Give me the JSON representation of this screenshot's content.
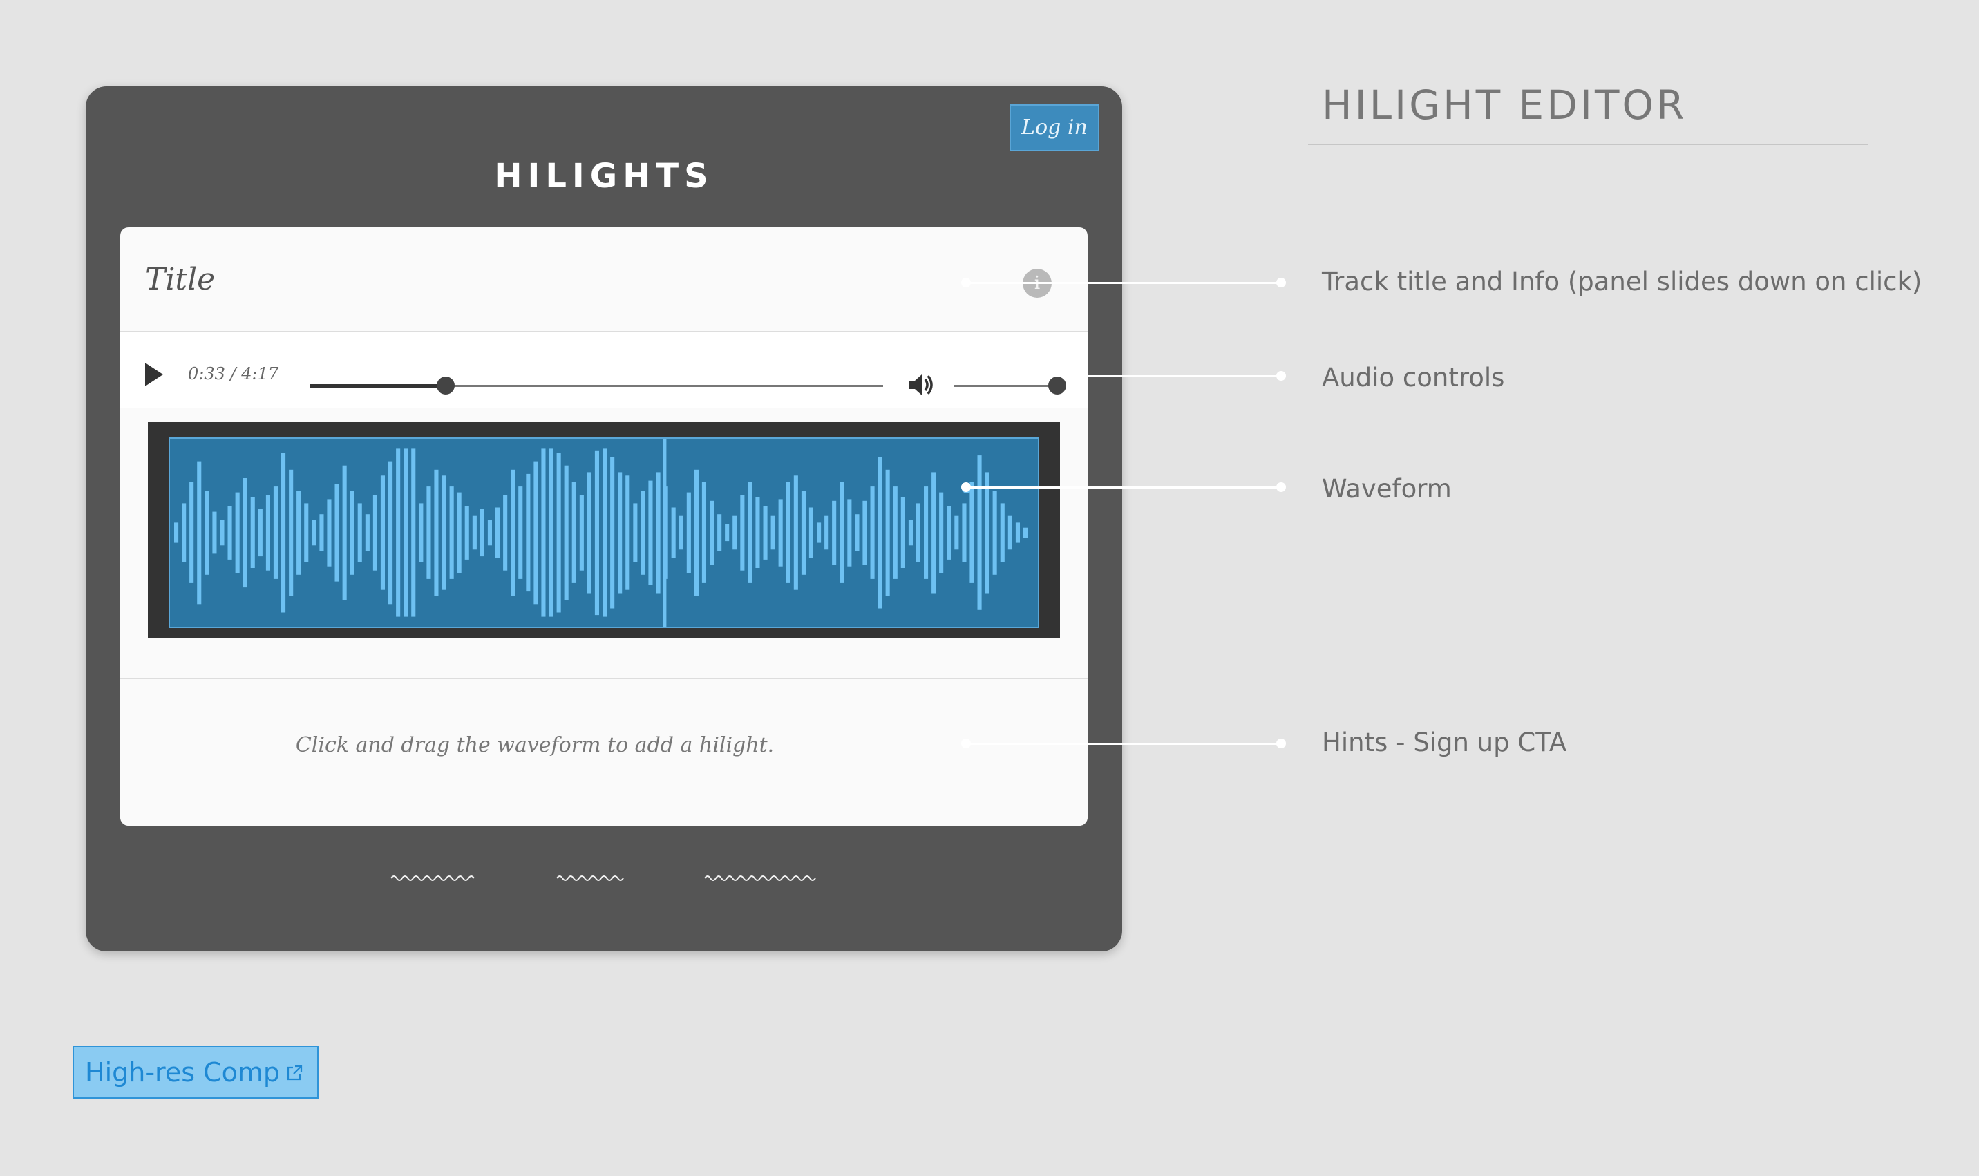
{
  "app": {
    "login_label": "Log in",
    "title": "HILIGHTS",
    "track_title": "Title",
    "info_icon_glyph": "i",
    "time_display": "0:33 / 4:17",
    "hint": "Click and drag the waveform to add a hilight."
  },
  "player": {
    "seek_progress": 0.237,
    "volume_level": 1.0,
    "playhead_position": 0.568,
    "selection_marker_position": 0.918
  },
  "waveform": {
    "bar_color": "#6ec1f2",
    "background_color": "#2b76a3",
    "amplitudes": [
      0.12,
      0.35,
      0.6,
      0.85,
      0.5,
      0.25,
      0.15,
      0.32,
      0.48,
      0.65,
      0.42,
      0.28,
      0.45,
      0.55,
      0.95,
      0.75,
      0.5,
      0.35,
      0.15,
      0.22,
      0.4,
      0.58,
      0.8,
      0.5,
      0.35,
      0.22,
      0.45,
      0.68,
      0.85,
      1.05,
      1.25,
      1.02,
      0.35,
      0.55,
      0.75,
      0.68,
      0.55,
      0.48,
      0.32,
      0.2,
      0.28,
      0.15,
      0.3,
      0.45,
      0.75,
      0.55,
      0.7,
      0.85,
      1.0,
      1.05,
      0.95,
      0.8,
      0.6,
      0.45,
      0.72,
      0.98,
      1.35,
      0.9,
      0.72,
      0.68,
      0.35,
      0.5,
      0.62,
      0.72,
      0.55,
      0.3,
      0.2,
      0.48,
      0.75,
      0.6,
      0.38,
      0.22,
      0.1,
      0.2,
      0.45,
      0.6,
      0.42,
      0.32,
      0.2,
      0.4,
      0.6,
      0.68,
      0.5,
      0.3,
      0.12,
      0.2,
      0.38,
      0.6,
      0.4,
      0.22,
      0.38,
      0.55,
      0.9,
      0.75,
      0.55,
      0.42,
      0.15,
      0.35,
      0.55,
      0.72,
      0.48,
      0.32,
      0.2,
      0.35,
      0.6,
      0.92,
      0.72,
      0.5,
      0.35,
      0.2,
      0.12,
      0.06
    ],
    "playhead_color": "#6ec1f2"
  },
  "footer_links": [
    "~~~~~",
    "~~~~",
    "~~~~~~"
  ],
  "annotations": {
    "heading": "HILIGHT EDITOR",
    "callouts": [
      {
        "id": "title-info",
        "text": "Track title and Info (panel slides down on click)"
      },
      {
        "id": "audio-controls",
        "text": "Audio controls"
      },
      {
        "id": "waveform",
        "text": "Waveform"
      },
      {
        "id": "hints",
        "text": "Hints - Sign up CTA"
      }
    ]
  },
  "hires_button": {
    "label": "High-res Comp",
    "icon": "external-link-icon"
  },
  "colors": {
    "page_background": "#e4e4e4",
    "device_frame": "#555555",
    "accent_blue": "#3d8bbd",
    "hires_button_bg": "#8acbf2",
    "hires_button_text": "#1e88d3"
  }
}
